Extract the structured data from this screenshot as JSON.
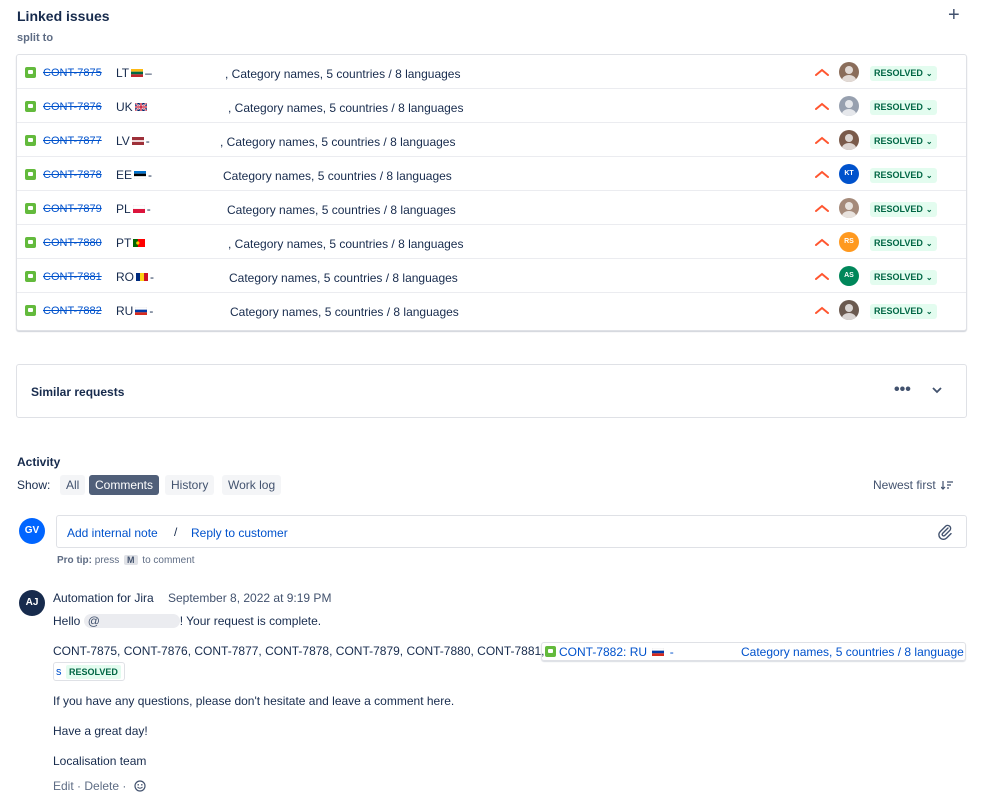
{
  "linked_issues": {
    "title": "Linked issues",
    "add_icon": "plus-icon",
    "relation": "split to",
    "items": [
      {
        "key": "CONT-7875",
        "code": "LT",
        "flag": "flag-lithuania-icon",
        "sep": "–",
        "summary": ", Category names, 5 countries / 8 languages",
        "priority": "high-priority-icon",
        "avatar": "",
        "avatar_color": "#8a6d5a",
        "status": "RESOLVED"
      },
      {
        "key": "CONT-7876",
        "code": "UK",
        "flag": "flag-uk-icon",
        "sep": "",
        "summary": ", Category names, 5 countries / 8 languages",
        "priority": "high-priority-icon",
        "avatar": "",
        "avatar_color": "#97a0af",
        "status": "RESOLVED"
      },
      {
        "key": "CONT-7877",
        "code": "LV",
        "flag": "flag-latvia-icon",
        "sep": "-",
        "summary": ", Category names, 5 countries / 8 languages",
        "priority": "high-priority-icon",
        "avatar": "",
        "avatar_color": "#7a5a4a",
        "status": "RESOLVED"
      },
      {
        "key": "CONT-7878",
        "code": "EE",
        "flag": "flag-estonia-icon",
        "sep": "-",
        "summary": "Category names, 5 countries / 8 languages",
        "priority": "high-priority-icon",
        "avatar": "KT",
        "avatar_color": "#0052cc",
        "status": "RESOLVED"
      },
      {
        "key": "CONT-7879",
        "code": "PL",
        "flag": "flag-poland-icon",
        "sep": "-",
        "summary": "Category names, 5 countries / 8 languages",
        "priority": "high-priority-icon",
        "avatar": "",
        "avatar_color": "#a58a7a",
        "status": "RESOLVED"
      },
      {
        "key": "CONT-7880",
        "code": "PT",
        "flag": "flag-portugal-icon",
        "sep": "",
        "summary": ", Category names, 5 countries / 8 languages",
        "priority": "high-priority-icon",
        "avatar": "RS",
        "avatar_color": "#ff991f",
        "status": "RESOLVED"
      },
      {
        "key": "CONT-7881",
        "code": "RO",
        "flag": "flag-romania-icon",
        "sep": "-",
        "summary": "Category names, 5 countries / 8 languages",
        "priority": "high-priority-icon",
        "avatar": "AS",
        "avatar_color": "#00875a",
        "status": "RESOLVED"
      },
      {
        "key": "CONT-7882",
        "code": "RU",
        "flag": "flag-russia-icon",
        "sep": "-",
        "summary": "Category names, 5 countries / 8 languages",
        "priority": "high-priority-icon",
        "avatar": "",
        "avatar_color": "#6b5a50",
        "status": "RESOLVED"
      }
    ]
  },
  "similar": {
    "title": "Similar requests",
    "more_icon": "more-icon",
    "chevron_icon": "chevron-down-icon"
  },
  "activity": {
    "title": "Activity",
    "show_label": "Show:",
    "filters": [
      {
        "label": "All",
        "active": false
      },
      {
        "label": "Comments",
        "active": true
      },
      {
        "label": "History",
        "active": false
      },
      {
        "label": "Work log",
        "active": false
      }
    ],
    "sort_label": "Newest first",
    "sort_icon": "sort-icon",
    "current_user_initials": "GV",
    "add_internal_note": "Add internal note",
    "separator": "/",
    "reply_to_customer": "Reply to customer",
    "attach_icon": "paperclip-icon",
    "pro_tip_label": "Pro tip:",
    "pro_tip_text1": "press",
    "pro_tip_key": "M",
    "pro_tip_text2": "to comment"
  },
  "comment": {
    "author_initials": "AJ",
    "author": "Automation for Jira",
    "date": "September 8, 2022 at 9:19 PM",
    "hello": "Hello",
    "mention": "@",
    "request_complete": "! Your request is complete.",
    "keys_line": "CONT-7875, CONT-7876, CONT-7877, CONT-7878, CONT-7879, CONT-7880, CONT-7881,",
    "inline_card_key": "CONT-7882: RU",
    "inline_card_dash": "-",
    "inline_card_summary": "Category names, 5 countries / 8 language",
    "inline_card_tail": "s",
    "inline_card_status": "RESOLVED",
    "questions": "If you have any questions, please don't hesitate and leave a comment here.",
    "great_day": "Have a great day!",
    "signature": "Localisation team",
    "edit": "Edit",
    "delete": "Delete",
    "dot": "·",
    "emoji_icon": "emoji-icon"
  },
  "colors": {
    "link": "#0052cc",
    "resolved_bg": "#e3fcef",
    "resolved_text": "#006644",
    "priority": "#ff5630",
    "story_green": "#63ba3c"
  }
}
